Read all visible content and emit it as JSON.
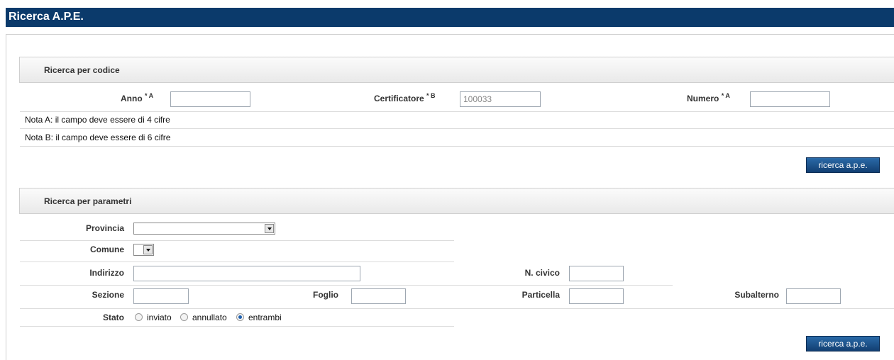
{
  "title": "Ricerca A.P.E.",
  "codice": {
    "header": "Ricerca per codice",
    "anno_label": "Anno",
    "anno_sup": "* A",
    "anno_value": "",
    "certificatore_label": "Certificatore",
    "certificatore_sup": "* B",
    "certificatore_value": "100033",
    "numero_label": "Numero",
    "numero_sup": "* A",
    "numero_value": "",
    "note_a": "Nota A: il campo deve essere di 4 cifre",
    "note_b": "Nota B: il campo deve essere di 6 cifre",
    "button": "ricerca a.p.e."
  },
  "parametri": {
    "header": "Ricerca per parametri",
    "provincia_label": "Provincia",
    "provincia_value": "",
    "comune_label": "Comune",
    "comune_value": "",
    "indirizzo_label": "Indirizzo",
    "civico_label": "N. civico",
    "sezione_label": "Sezione",
    "foglio_label": "Foglio",
    "particella_label": "Particella",
    "subalterno_label": "Subalterno",
    "stato_label": "Stato",
    "stato_options": [
      "inviato",
      "annullato",
      "entrambi"
    ],
    "stato_selected": "entrambi",
    "button": "ricerca a.p.e."
  }
}
